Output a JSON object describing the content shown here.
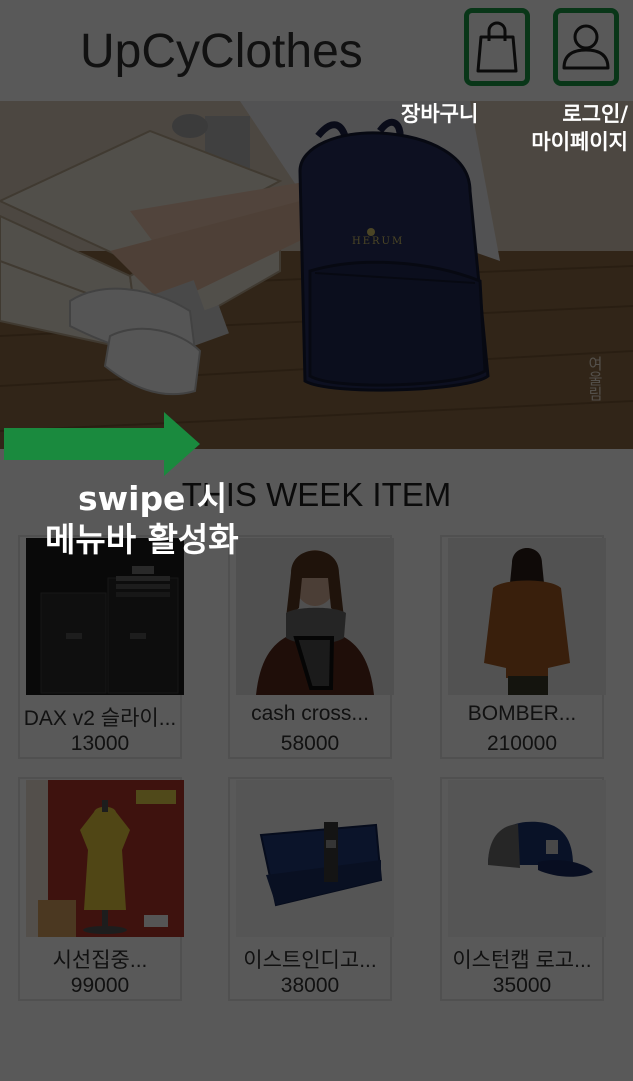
{
  "header": {
    "app_title": "UpCyClothes",
    "cart_icon": "shopping-bag-icon",
    "login_icon": "user-icon",
    "accent_color": "#1a9a46"
  },
  "banner": {
    "bag_logo": "HERUM",
    "watermark": "여울림"
  },
  "section": {
    "title": "THIS WEEK ITEM"
  },
  "products": [
    {
      "name": "DAX v2 슬라이...",
      "price": "13000"
    },
    {
      "name": "cash cross...",
      "price": "58000"
    },
    {
      "name": "BOMBER...",
      "price": "210000"
    },
    {
      "name": "시선집중...",
      "price": "99000"
    },
    {
      "name": "이스트인디고...",
      "price": "38000"
    },
    {
      "name": "이스턴캡 로고...",
      "price": "35000"
    }
  ],
  "annotations": {
    "cart_label": "장바구니",
    "login_label_line1": "로그인/",
    "login_label_line2": "마이페이지",
    "swipe_label_line1": "swipe 시",
    "swipe_label_line2": "메뉴바 활성화"
  }
}
